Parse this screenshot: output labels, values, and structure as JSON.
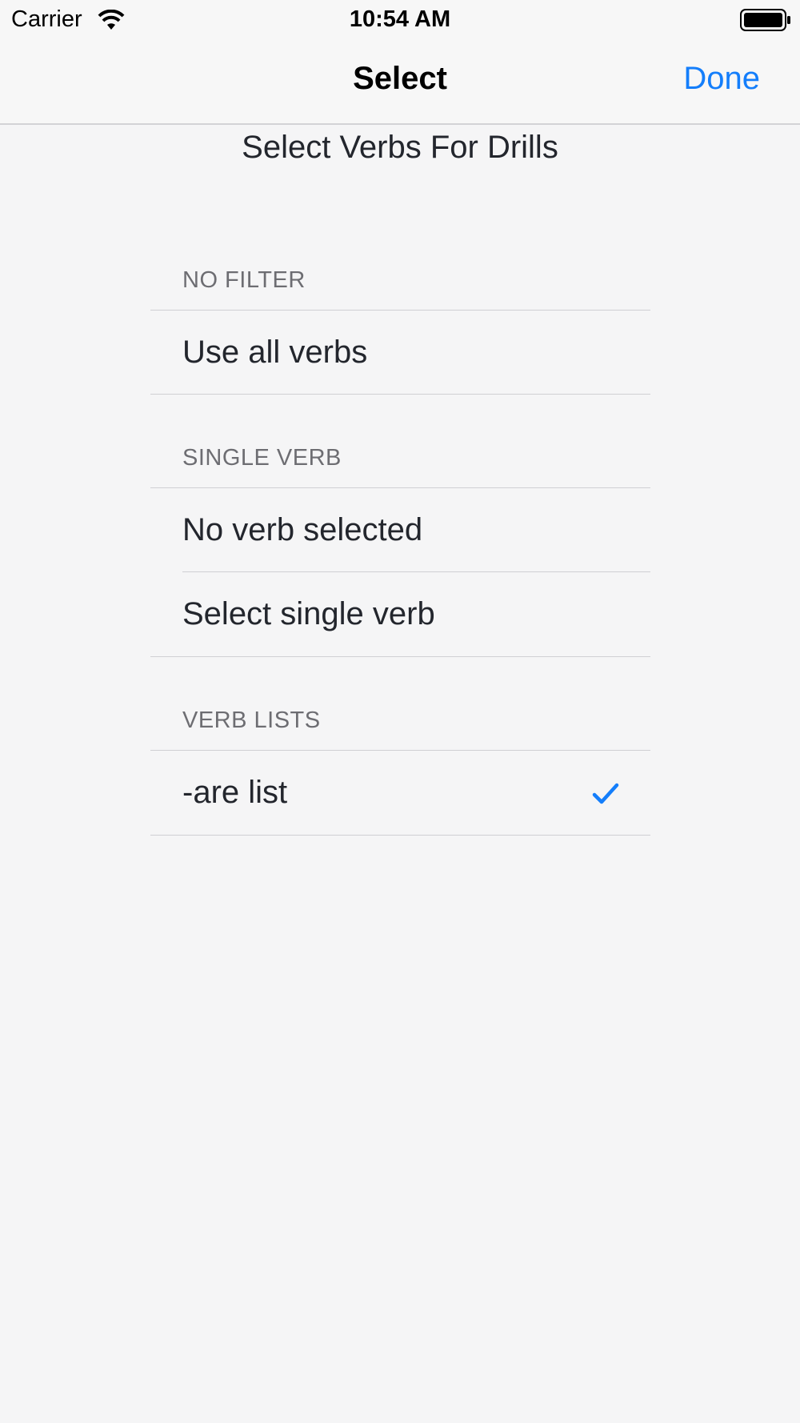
{
  "status_bar": {
    "carrier": "Carrier",
    "time": "10:54 AM"
  },
  "nav": {
    "title": "Select",
    "done_label": "Done"
  },
  "heading": "Select Verbs For Drills",
  "sections": [
    {
      "header": "NO FILTER",
      "rows": [
        {
          "label": "Use all verbs",
          "checked": false
        }
      ]
    },
    {
      "header": "SINGLE VERB",
      "rows": [
        {
          "label": "No verb selected",
          "checked": false
        },
        {
          "label": "Select single verb",
          "checked": false
        }
      ]
    },
    {
      "header": "VERB LISTS",
      "rows": [
        {
          "label": "-are list",
          "checked": true
        }
      ]
    }
  ],
  "icons": {
    "wifi": "wifi-icon",
    "battery": "battery-icon",
    "checkmark": "checkmark-icon"
  },
  "colors": {
    "accent": "#147efb",
    "background": "#f5f5f6",
    "header_text": "#6d6d72"
  }
}
